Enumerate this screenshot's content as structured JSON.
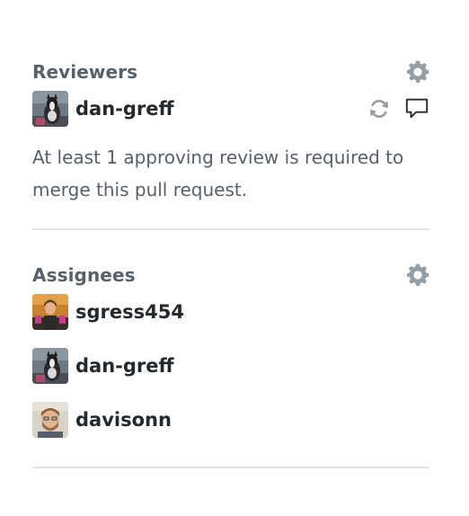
{
  "reviewers": {
    "title": "Reviewers",
    "settings_icon": "gear-icon",
    "users": [
      {
        "name": "dan-greff",
        "avatar": "avatar-dan-greff"
      }
    ],
    "row_icons": [
      "sync-icon",
      "comment-icon"
    ],
    "note": "At least 1 approving review is required to merge this pull request."
  },
  "assignees": {
    "title": "Assignees",
    "settings_icon": "gear-icon",
    "users": [
      {
        "name": "sgress454",
        "avatar": "avatar-sgress454"
      },
      {
        "name": "dan-greff",
        "avatar": "avatar-dan-greff"
      },
      {
        "name": "davisonn",
        "avatar": "avatar-davisonn"
      }
    ]
  },
  "colors": {
    "heading": "#586069",
    "text": "#24292e",
    "icon": "#959da5",
    "divider": "#e1e4e8"
  }
}
